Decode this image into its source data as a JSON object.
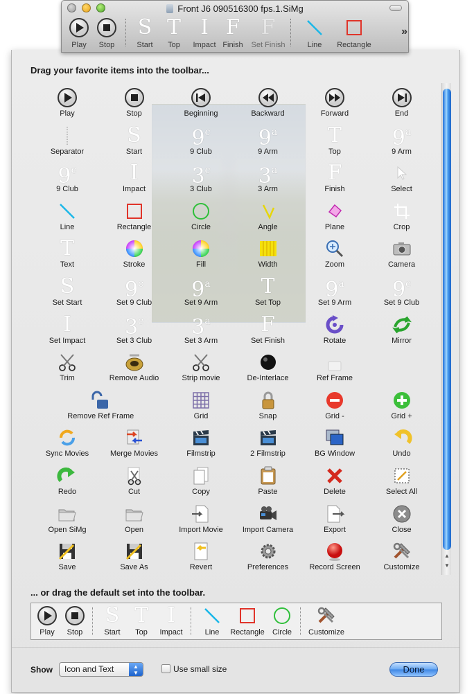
{
  "window": {
    "title": "Front J6 090516300 fps.1.SiMg",
    "toolbar": [
      {
        "label": "Play",
        "icon": "play-icon",
        "glyph": ""
      },
      {
        "label": "Stop",
        "icon": "stop-icon",
        "glyph": ""
      },
      {
        "label": "Start",
        "icon": "start-letter-icon",
        "glyph": "S"
      },
      {
        "label": "Top",
        "icon": "top-letter-icon",
        "glyph": "T"
      },
      {
        "label": "Impact",
        "icon": "impact-letter-icon",
        "glyph": "I"
      },
      {
        "label": "Finish",
        "icon": "finish-letter-icon",
        "glyph": "F"
      },
      {
        "label": "Set Finish",
        "icon": "set-finish-letter-icon",
        "glyph": "F"
      },
      {
        "label": "Line",
        "icon": "line-icon",
        "glyph": ""
      },
      {
        "label": "Rectangle",
        "icon": "rectangle-icon",
        "glyph": ""
      }
    ]
  },
  "sheet": {
    "drag_header": "Drag your favorite items into the toolbar...",
    "default_header": "... or drag the default set into the toolbar."
  },
  "items": [
    {
      "label": "Play",
      "icon": "play-icon",
      "glyph": ""
    },
    {
      "label": "Stop",
      "icon": "stop-icon",
      "glyph": ""
    },
    {
      "label": "Beginning",
      "icon": "beginning-icon",
      "glyph": ""
    },
    {
      "label": "Backward",
      "icon": "backward-icon",
      "glyph": ""
    },
    {
      "label": "Forward",
      "icon": "forward-icon",
      "glyph": ""
    },
    {
      "label": "End",
      "icon": "end-icon",
      "glyph": ""
    },
    {
      "label": "Separator",
      "icon": "separator-icon",
      "glyph": ""
    },
    {
      "label": "Start",
      "icon": "start-letter-icon",
      "glyph": "S"
    },
    {
      "label": "9 Club",
      "icon": "club-letter-icon",
      "glyph": "9",
      "sup": "c"
    },
    {
      "label": "9 Arm",
      "icon": "arm-letter-icon",
      "glyph": "9",
      "sup": "a"
    },
    {
      "label": "Top",
      "icon": "top-letter-icon",
      "glyph": "T"
    },
    {
      "label": "9 Arm",
      "icon": "arm-letter-icon",
      "glyph": "9",
      "sup": "a"
    },
    {
      "label": "9 Club",
      "icon": "club-letter-icon",
      "glyph": "9",
      "sup": "c"
    },
    {
      "label": "Impact",
      "icon": "impact-letter-icon",
      "glyph": "I"
    },
    {
      "label": "3 Club",
      "icon": "club-letter-icon",
      "glyph": "3",
      "sup": "c"
    },
    {
      "label": "3 Arm",
      "icon": "arm-letter-icon",
      "glyph": "3",
      "sup": "a"
    },
    {
      "label": "Finish",
      "icon": "finish-letter-icon",
      "glyph": "F"
    },
    {
      "label": "Select",
      "icon": "select-arrow-icon",
      "glyph": ""
    },
    {
      "label": "Line",
      "icon": "line-icon",
      "glyph": ""
    },
    {
      "label": "Rectangle",
      "icon": "rectangle-icon",
      "glyph": ""
    },
    {
      "label": "Circle",
      "icon": "circle-icon",
      "glyph": ""
    },
    {
      "label": "Angle",
      "icon": "angle-icon",
      "glyph": ""
    },
    {
      "label": "Plane",
      "icon": "plane-icon",
      "glyph": ""
    },
    {
      "label": "Crop",
      "icon": "crop-icon",
      "glyph": ""
    },
    {
      "label": "Text",
      "icon": "text-letter-icon",
      "glyph": "T"
    },
    {
      "label": "Stroke",
      "icon": "color-wheel-icon",
      "glyph": ""
    },
    {
      "label": "Fill",
      "icon": "color-wheel-icon",
      "glyph": ""
    },
    {
      "label": "Width",
      "icon": "width-icon",
      "glyph": ""
    },
    {
      "label": "Zoom",
      "icon": "zoom-icon",
      "glyph": ""
    },
    {
      "label": "Camera",
      "icon": "camera-icon",
      "glyph": ""
    },
    {
      "label": "Set Start",
      "icon": "start-letter-icon",
      "glyph": "S"
    },
    {
      "label": "Set 9 Club",
      "icon": "club-letter-icon",
      "glyph": "9",
      "sup": "c"
    },
    {
      "label": "Set 9 Arm",
      "icon": "arm-letter-icon",
      "glyph": "9",
      "sup": "a"
    },
    {
      "label": "Set Top",
      "icon": "top-letter-icon",
      "glyph": "T"
    },
    {
      "label": "Set 9 Arm",
      "icon": "arm-letter-icon",
      "glyph": "9",
      "sup": "a"
    },
    {
      "label": "Set 9 Club",
      "icon": "club-letter-icon",
      "glyph": "9",
      "sup": "c"
    },
    {
      "label": "Set Impact",
      "icon": "impact-letter-icon",
      "glyph": "I"
    },
    {
      "label": "Set 3 Club",
      "icon": "club-letter-icon",
      "glyph": "3",
      "sup": "c"
    },
    {
      "label": "Set 3 Arm",
      "icon": "arm-letter-icon",
      "glyph": "3",
      "sup": "a"
    },
    {
      "label": "Set Finish",
      "icon": "finish-letter-icon",
      "glyph": "F"
    },
    {
      "label": "Rotate",
      "icon": "rotate-icon",
      "glyph": ""
    },
    {
      "label": "Mirror",
      "icon": "mirror-icon",
      "glyph": ""
    },
    {
      "label": "Trim",
      "icon": "scissors-icon",
      "glyph": ""
    },
    {
      "label": "Remove Audio",
      "icon": "speaker-icon",
      "glyph": ""
    },
    {
      "label": "Strip movie",
      "icon": "scissors-icon",
      "glyph": ""
    },
    {
      "label": "De-Interlace",
      "icon": "deinterlace-icon",
      "glyph": ""
    },
    {
      "label": "Ref Frame",
      "icon": "lock-icon",
      "glyph": ""
    },
    {
      "label": "",
      "icon": "",
      "glyph": ""
    },
    {
      "label": "Remove Ref Frame",
      "icon": "unlock-icon",
      "glyph": ""
    },
    {
      "label": "",
      "icon": "",
      "glyph": ""
    },
    {
      "label": "Grid",
      "icon": "grid-icon",
      "glyph": ""
    },
    {
      "label": "Snap",
      "icon": "padlock-icon",
      "glyph": ""
    },
    {
      "label": "Grid -",
      "icon": "minus-circle-icon",
      "glyph": ""
    },
    {
      "label": "Grid +",
      "icon": "plus-circle-icon",
      "glyph": ""
    },
    {
      "label": "Sync Movies",
      "icon": "sync-icon",
      "glyph": ""
    },
    {
      "label": "Merge Movies",
      "icon": "merge-icon",
      "glyph": ""
    },
    {
      "label": "Filmstrip",
      "icon": "clapper-icon",
      "glyph": ""
    },
    {
      "label": "2 Filmstrip",
      "icon": "clapper-icon",
      "glyph": ""
    },
    {
      "label": "BG Window",
      "icon": "window-icon",
      "glyph": ""
    },
    {
      "label": "Undo",
      "icon": "undo-icon",
      "glyph": ""
    },
    {
      "label": "Redo",
      "icon": "redo-icon",
      "glyph": ""
    },
    {
      "label": "Cut",
      "icon": "cut-icon",
      "glyph": ""
    },
    {
      "label": "Copy",
      "icon": "copy-icon",
      "glyph": ""
    },
    {
      "label": "Paste",
      "icon": "paste-icon",
      "glyph": ""
    },
    {
      "label": "Delete",
      "icon": "delete-x-icon",
      "glyph": ""
    },
    {
      "label": "Select All",
      "icon": "select-all-icon",
      "glyph": ""
    },
    {
      "label": "Open SiMg",
      "icon": "folder-icon",
      "glyph": ""
    },
    {
      "label": "Open",
      "icon": "folder-icon",
      "glyph": ""
    },
    {
      "label": "Import Movie",
      "icon": "import-icon",
      "glyph": ""
    },
    {
      "label": "Import Camera",
      "icon": "video-camera-icon",
      "glyph": ""
    },
    {
      "label": "Export",
      "icon": "export-icon",
      "glyph": ""
    },
    {
      "label": "Close",
      "icon": "close-icon",
      "glyph": ""
    },
    {
      "label": "Save",
      "icon": "save-icon",
      "glyph": ""
    },
    {
      "label": "Save As",
      "icon": "save-icon",
      "glyph": ""
    },
    {
      "label": "Revert",
      "icon": "revert-icon",
      "glyph": ""
    },
    {
      "label": "Preferences",
      "icon": "gear-icon",
      "glyph": ""
    },
    {
      "label": "Record Screen",
      "icon": "record-icon",
      "glyph": ""
    },
    {
      "label": "Customize",
      "icon": "tools-icon",
      "glyph": ""
    }
  ],
  "default_set": [
    {
      "label": "Play",
      "icon": "play-icon",
      "glyph": ""
    },
    {
      "label": "Stop",
      "icon": "stop-icon",
      "glyph": ""
    },
    {
      "label": "Start",
      "icon": "start-letter-icon",
      "glyph": "S"
    },
    {
      "label": "Top",
      "icon": "top-letter-icon",
      "glyph": "T"
    },
    {
      "label": "Impact",
      "icon": "impact-letter-icon",
      "glyph": "I"
    },
    {
      "label": "Line",
      "icon": "line-icon",
      "glyph": ""
    },
    {
      "label": "Rectangle",
      "icon": "rectangle-icon",
      "glyph": ""
    },
    {
      "label": "Circle",
      "icon": "circle-icon",
      "glyph": ""
    },
    {
      "label": "Customize",
      "icon": "tools-icon",
      "glyph": ""
    }
  ],
  "footer": {
    "show_label": "Show",
    "show_value": "Icon and Text",
    "small_size_label": "Use small size",
    "small_size_checked": false,
    "done_label": "Done"
  },
  "colors": {
    "accent_blue": "#3e86e4",
    "shape_cyan": "#19b7e8",
    "shape_red": "#e0342a",
    "shape_green": "#2fbf3a"
  }
}
